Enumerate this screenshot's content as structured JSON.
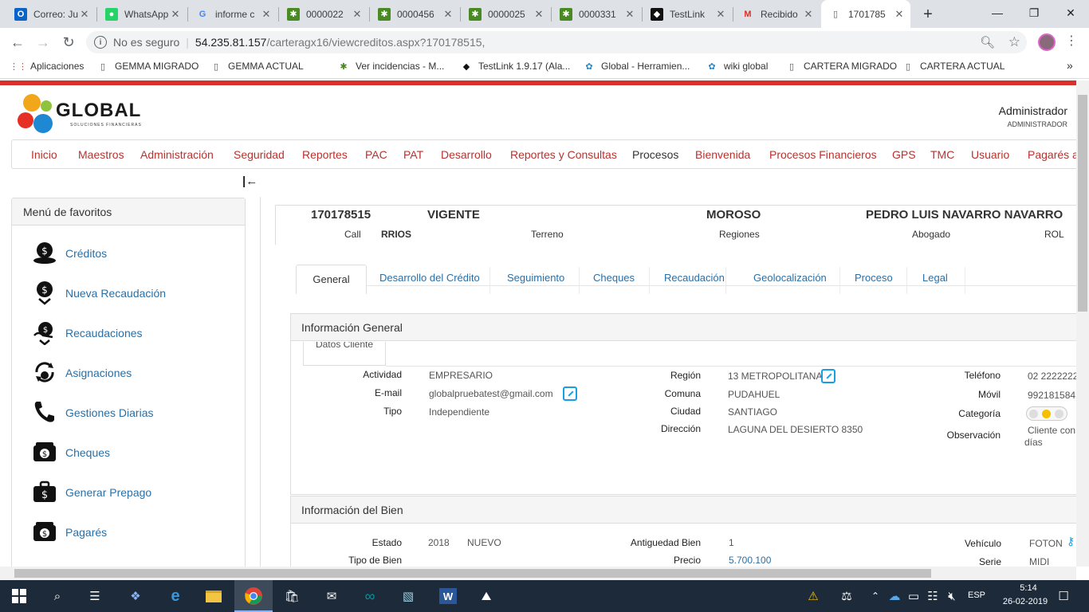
{
  "browser": {
    "tabs": [
      {
        "title": "Correo: Ju",
        "icon": "outlook-icon",
        "color": "#0a64c8"
      },
      {
        "title": "WhatsApp",
        "icon": "whatsapp-icon",
        "color": "#25d366"
      },
      {
        "title": "informe c",
        "icon": "google-icon",
        "color": "#4285f4"
      },
      {
        "title": "0000022",
        "icon": "mantis-icon",
        "color": "#4a8a22"
      },
      {
        "title": "0000456",
        "icon": "mantis-icon",
        "color": "#4a8a22"
      },
      {
        "title": "0000025",
        "icon": "mantis-icon",
        "color": "#4a8a22"
      },
      {
        "title": "0000331",
        "icon": "mantis-icon",
        "color": "#4a8a22"
      },
      {
        "title": "TestLink",
        "icon": "testlink-icon",
        "color": "#111111"
      },
      {
        "title": "Recibido",
        "icon": "gmail-icon",
        "color": "#d93025"
      },
      {
        "title": "1701785",
        "icon": "page-icon",
        "color": "#5f6368"
      }
    ],
    "url_security": "No es seguro",
    "url_host": "54.235.81.157",
    "url_path": "/carteragx16/viewcreditos.aspx?170178515,",
    "bookmarks": [
      {
        "label": "Aplicaciones",
        "icon": "apps-icon"
      },
      {
        "label": "GEMMA MIGRADO",
        "icon": "page-icon"
      },
      {
        "label": "GEMMA ACTUAL",
        "icon": "page-icon"
      },
      {
        "label": "Ver incidencias - M...",
        "icon": "mantis-icon"
      },
      {
        "label": "TestLink 1.9.17 (Ala...",
        "icon": "testlink-icon"
      },
      {
        "label": "Global - Herramien...",
        "icon": "global-icon"
      },
      {
        "label": "wiki global",
        "icon": "global-icon"
      },
      {
        "label": "CARTERA MIGRADO",
        "icon": "page-icon"
      },
      {
        "label": "CARTERA ACTUAL",
        "icon": "page-icon"
      }
    ],
    "bookmarks_more": "»"
  },
  "header": {
    "logo_text": "GLOBAL",
    "logo_sub": "SOLUCIONES FINANCIERAS",
    "user_name": "Administrador",
    "user_role": "ADMINISTRADOR"
  },
  "nav": [
    "Inicio",
    "Maestros",
    "Administración",
    "Seguridad",
    "Reportes",
    "PAC",
    "PAT",
    "Desarrollo",
    "Reportes y Consultas",
    "Procesos",
    "Bienvenida",
    "Procesos Financieros",
    "GPS",
    "TMC",
    "Usuario",
    "Pagarés a"
  ],
  "collapse_glyph": "|←",
  "favorites": {
    "title": "Menú de favoritos",
    "items": [
      {
        "label": "Créditos",
        "icon": "money-head-icon"
      },
      {
        "label": "Nueva Recaudación",
        "icon": "money-in-icon"
      },
      {
        "label": "Recaudaciones",
        "icon": "money-hand-icon"
      },
      {
        "label": "Asignaciones",
        "icon": "cycle-money-icon"
      },
      {
        "label": "Gestiones Diarias",
        "icon": "phone-icon"
      },
      {
        "label": "Cheques",
        "icon": "cash-icon"
      },
      {
        "label": "Generar Prepago",
        "icon": "briefcase-icon"
      },
      {
        "label": "Pagarés",
        "icon": "wallet-icon"
      }
    ]
  },
  "credit": {
    "id": "170178515",
    "status": "VIGENTE",
    "state2": "MOROSO",
    "client": "PEDRO LUIS NAVARRO NAVARRO",
    "call_label": "Call",
    "call_value": "RRIOS",
    "terreno": "Terreno",
    "regiones": "Regiones",
    "abogado": "Abogado",
    "rol": "ROL"
  },
  "tabs": [
    "General",
    "Desarrollo del Crédito",
    "Seguimiento",
    "Cheques",
    "Recaudación",
    "Geolocalización",
    "Proceso",
    "Legal"
  ],
  "info_general": {
    "title": "Información General",
    "subtab": "Datos Cliente",
    "actividad_l": "Actividad",
    "actividad_v": "EMPRESARIO",
    "email_l": "E-mail",
    "email_v": "globalpruebatest@gmail.com",
    "tipo_l": "Tipo",
    "tipo_v": "Independiente",
    "region_l": "Región",
    "region_v": "13 METROPOLITANA",
    "comuna_l": "Comuna",
    "comuna_v": "PUDAHUEL",
    "ciudad_l": "Ciudad",
    "ciudad_v": "SANTIAGO",
    "direccion_l": "Dirección",
    "direccion_v": "LAGUNA DEL DESIERTO 8350",
    "telefono_l": "Teléfono",
    "telefono_v": "02 2222222",
    "movil_l": "Móvil",
    "movil_v": "992181584",
    "categoria_l": "Categoría",
    "observacion_l": "Observación",
    "observacion_v1": "Cliente con",
    "observacion_v2": "días"
  },
  "info_bien": {
    "title": "Información del Bien",
    "estado_l": "Estado",
    "estado_year": "2018",
    "estado_v": "NUEVO",
    "tipo_l": "Tipo de Bien",
    "antig_l": "Antiguedad Bien",
    "antig_v": "1",
    "precio_l": "Precio",
    "precio_v": "5.700.100",
    "vehiculo_l": "Vehículo",
    "vehiculo_v": "FOTON",
    "serie_l": "Serie",
    "serie_v": "MIDI"
  },
  "taskbar": {
    "lang": "ESP",
    "time": "5:14",
    "date": "26-02-2019"
  }
}
